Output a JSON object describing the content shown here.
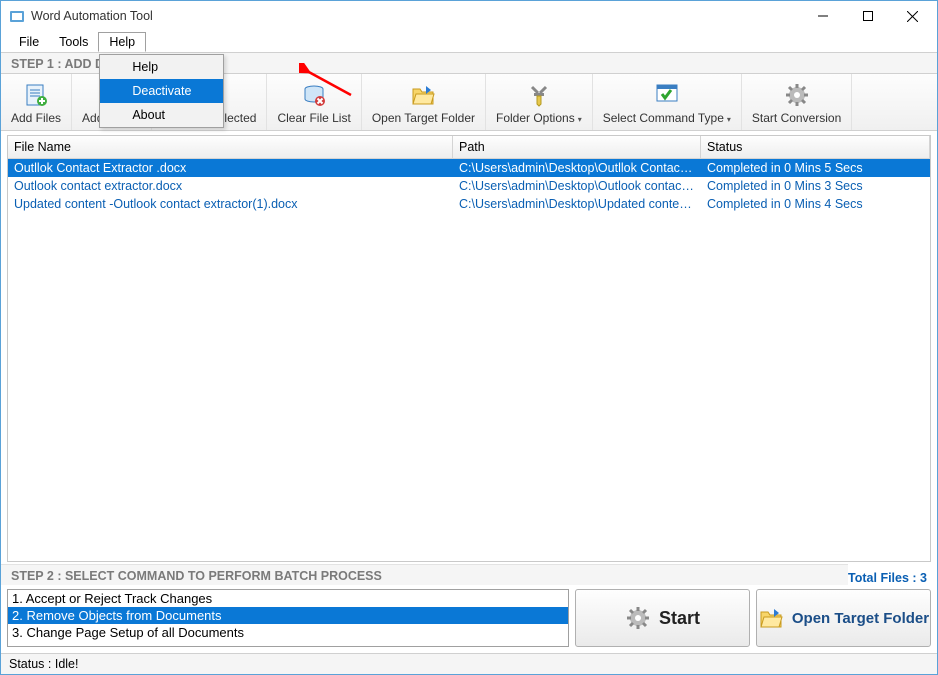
{
  "window": {
    "title": "Word Automation Tool"
  },
  "menubar": {
    "file": "File",
    "tools": "Tools",
    "help": "Help"
  },
  "help_menu": {
    "help": "Help",
    "deactivate": "Deactivate",
    "about": "About"
  },
  "step1_label": "STEP 1 : ADD                                      DOCX, RTF)",
  "toolbar": {
    "add_files": "Add Files",
    "add_folder": "Add Folder",
    "remove_selected": "Remove Selected",
    "clear_list": "Clear File List",
    "open_target": "Open Target Folder",
    "folder_options": "Folder Options",
    "select_cmd": "Select Command Type",
    "start_conv": "Start Conversion"
  },
  "grid": {
    "headers": {
      "file": "File Name",
      "path": "Path",
      "status": "Status"
    },
    "rows": [
      {
        "file": "Outllok Contact Extractor .docx",
        "path": "C:\\Users\\admin\\Desktop\\Outllok Contact ...",
        "status": "Completed in 0 Mins 5 Secs",
        "selected": true
      },
      {
        "file": "Outlook contact extractor.docx",
        "path": "C:\\Users\\admin\\Desktop\\Outlook contact...",
        "status": "Completed in 0 Mins 3 Secs",
        "selected": false
      },
      {
        "file": "Updated content -Outlook contact extractor(1).docx",
        "path": "C:\\Users\\admin\\Desktop\\Updated conten...",
        "status": "Completed in 0 Mins 4 Secs",
        "selected": false
      }
    ]
  },
  "total_files": "Total Files : 3",
  "step2_label": "STEP 2 : SELECT COMMAND TO PERFORM BATCH PROCESS",
  "commands": {
    "items": [
      "1. Accept or Reject Track Changes",
      "2. Remove Objects from Documents",
      "3. Change Page Setup of all Documents"
    ],
    "selected_index": 1
  },
  "buttons": {
    "start": "Start",
    "open_target": "Open Target Folder"
  },
  "status": "Status  :  Idle!"
}
